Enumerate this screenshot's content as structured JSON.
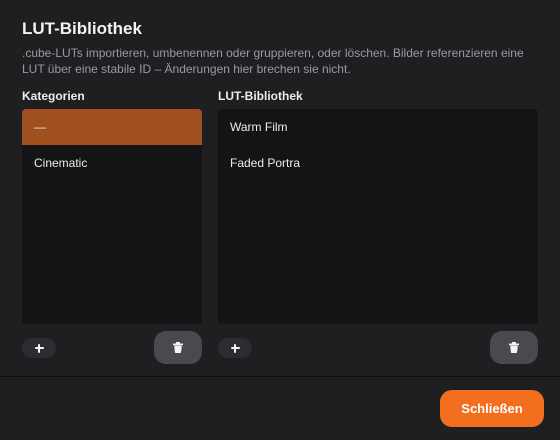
{
  "dialog": {
    "title": "LUT-Bibliothek",
    "description": ".cube-LUTs importieren, umbenennen oder gruppieren, oder löschen. Bilder referenzieren eine LUT über eine stabile ID – Änderungen hier brechen sie nicht."
  },
  "categories": {
    "heading": "Kategorien",
    "items": [
      {
        "label": "—",
        "selected": true
      },
      {
        "label": "Cinematic",
        "selected": false
      }
    ],
    "add_label": "+",
    "delete_icon": "trash-icon"
  },
  "library": {
    "heading": "LUT-Bibliothek",
    "items": [
      {
        "label": "Warm Film"
      },
      {
        "label": "Faded Portra"
      }
    ],
    "add_label": "+",
    "delete_icon": "trash-icon"
  },
  "footer": {
    "close_label": "Schließen"
  },
  "colors": {
    "background": "#1f1f22",
    "panel": "#141416",
    "selected_row": "#a0511f",
    "accent": "#f36f1f"
  }
}
